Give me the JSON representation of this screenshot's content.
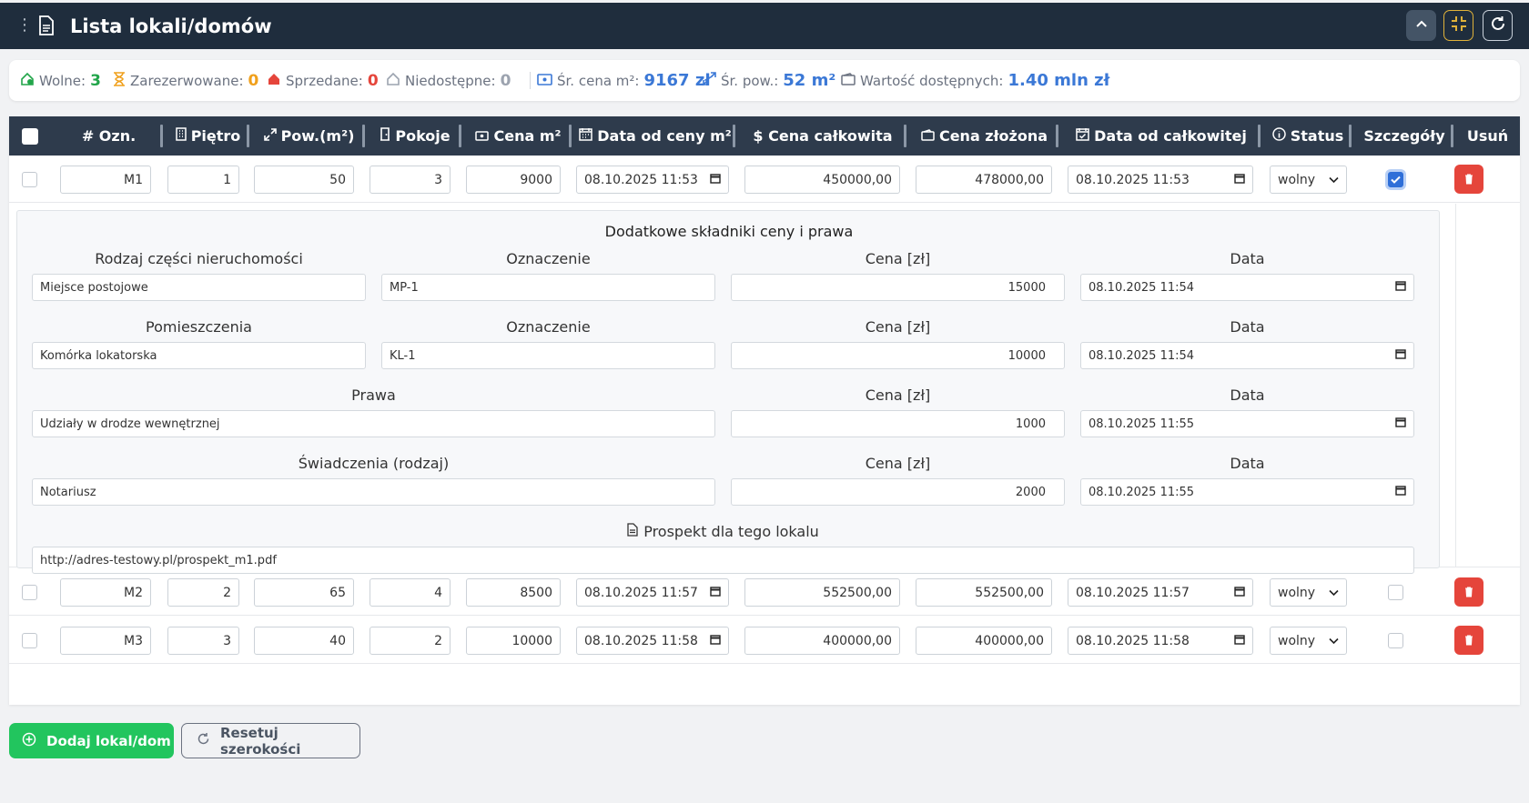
{
  "header": {
    "title": "Lista lokali/domów"
  },
  "stats": {
    "wolne_label": "Wolne:",
    "wolne_value": "3",
    "zarezerwowane_label": "Zarezerwowane:",
    "zarezerwowane_value": "0",
    "sprzedane_label": "Sprzedane:",
    "sprzedane_value": "0",
    "niedostepne_label": "Niedostępne:",
    "niedostepne_value": "0",
    "sr_cena_label": "Śr. cena m²:",
    "sr_cena_value": "9167 zł",
    "sr_pow_label": "Śr. pow.:",
    "sr_pow_value": "52 m²",
    "wartosc_label": "Wartość dostępnych:",
    "wartosc_value": "1.40 mln zł",
    "colors": {
      "wolne": "#22a54a",
      "zarezerwowane": "#f0a01c",
      "sprzedane": "#e5453b",
      "niedostepne": "#9ca3af",
      "info": "#3b78d6"
    }
  },
  "columns": {
    "ozn": "# Ozn.",
    "pietro": "Piętro",
    "pow": "Pow.(m²)",
    "pokoje": "Pokoje",
    "cena_m2": "Cena m²",
    "data_ceny_m2": "Data od ceny m²",
    "cena_calk": "$ Cena całkowita",
    "cena_zlozona": "Cena złożona",
    "data_calk": "Data od całkowitej",
    "status": "Status",
    "szczegoly": "Szczegóły",
    "usun": "Usuń"
  },
  "rows": [
    {
      "ozn": "M1",
      "pietro": "1",
      "pow": "50",
      "pokoje": "3",
      "cena_m2": "9000",
      "data_m2": "08.10.2025 11:53",
      "cena_calk": "450000,00",
      "cena_zlozona": "478000,00",
      "data_calk": "08.10.2025 11:53",
      "status": "wolny",
      "details_open": true
    },
    {
      "ozn": "M2",
      "pietro": "2",
      "pow": "65",
      "pokoje": "4",
      "cena_m2": "8500",
      "data_m2": "08.10.2025 11:57",
      "cena_calk": "552500,00",
      "cena_zlozona": "552500,00",
      "data_calk": "08.10.2025 11:57",
      "status": "wolny",
      "details_open": false
    },
    {
      "ozn": "M3",
      "pietro": "3",
      "pow": "40",
      "pokoje": "2",
      "cena_m2": "10000",
      "data_m2": "08.10.2025 11:58",
      "cena_calk": "400000,00",
      "cena_zlozona": "400000,00",
      "data_calk": "08.10.2025 11:58",
      "status": "wolny",
      "details_open": false
    }
  ],
  "details": {
    "title": "Dodatkowe składniki ceny i prawa",
    "section1": {
      "label_rodzaj": "Rodzaj części nieruchomości",
      "label_ozn": "Oznaczenie",
      "label_cena": "Cena [zł]",
      "label_data": "Data",
      "rodzaj": "Miejsce postojowe",
      "ozn": "MP-1",
      "cena": "15000",
      "data": "08.10.2025 11:54"
    },
    "section2": {
      "label_rodzaj": "Pomieszczenia",
      "label_ozn": "Oznaczenie",
      "label_cena": "Cena [zł]",
      "label_data": "Data",
      "rodzaj": "Komórka lokatorska",
      "ozn": "KL-1",
      "cena": "10000",
      "data": "08.10.2025 11:54"
    },
    "section3": {
      "label_rodzaj": "Prawa",
      "label_cena": "Cena [zł]",
      "label_data": "Data",
      "rodzaj": "Udziały w drodze wewnętrznej",
      "cena": "1000",
      "data": "08.10.2025 11:55"
    },
    "section4": {
      "label_rodzaj": "Świadczenia (rodzaj)",
      "label_cena": "Cena [zł]",
      "label_data": "Data",
      "rodzaj": "Notariusz",
      "cena": "2000",
      "data": "08.10.2025 11:55"
    },
    "prospekt_label": "Prospekt dla tego lokalu",
    "prospekt_url": "http://adres-testowy.pl/prospekt_m1.pdf"
  },
  "buttons": {
    "add": "Dodaj lokal/dom",
    "reset": "Resetuj szerokości"
  }
}
